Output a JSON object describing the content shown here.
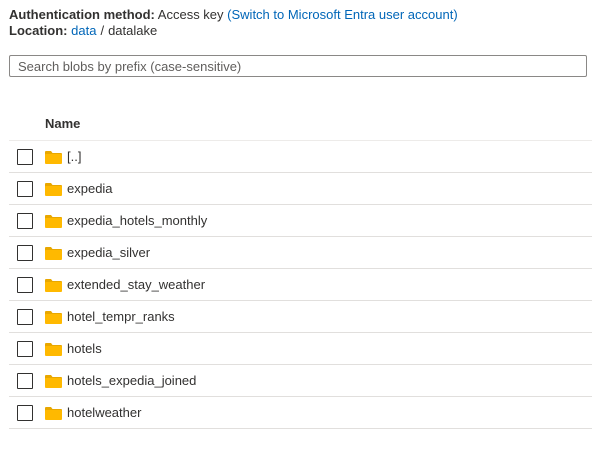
{
  "auth": {
    "label": "Authentication method:",
    "value": "Access key",
    "switch_link": "(Switch to Microsoft Entra user account)"
  },
  "location": {
    "label": "Location:",
    "path": [
      {
        "name": "data"
      },
      {
        "name": "datalake"
      }
    ],
    "separator": "/"
  },
  "search": {
    "placeholder": "Search blobs by prefix (case-sensitive)",
    "value": ""
  },
  "table": {
    "column_name": "Name",
    "rows": [
      {
        "name": "[..]",
        "icon": "folder-icon"
      },
      {
        "name": "expedia",
        "icon": "folder-icon"
      },
      {
        "name": "expedia_hotels_monthly",
        "icon": "folder-icon"
      },
      {
        "name": "expedia_silver",
        "icon": "folder-icon"
      },
      {
        "name": "extended_stay_weather",
        "icon": "folder-icon"
      },
      {
        "name": "hotel_tempr_ranks",
        "icon": "folder-icon"
      },
      {
        "name": "hotels",
        "icon": "folder-icon"
      },
      {
        "name": "hotels_expedia_joined",
        "icon": "folder-icon"
      },
      {
        "name": "hotelweather",
        "icon": "folder-icon"
      }
    ]
  },
  "colors": {
    "link": "#0066b8",
    "folder": "#ffb900",
    "folder_dark": "#e8a700",
    "text": "#323130"
  }
}
